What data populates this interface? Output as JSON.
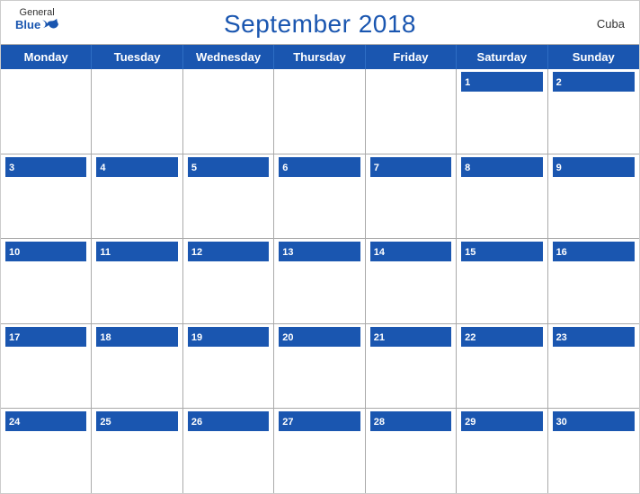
{
  "header": {
    "logo_general": "General",
    "logo_blue": "Blue",
    "title": "September 2018",
    "country": "Cuba"
  },
  "days_of_week": [
    "Monday",
    "Tuesday",
    "Wednesday",
    "Thursday",
    "Friday",
    "Saturday",
    "Sunday"
  ],
  "weeks": [
    [
      {
        "date": "",
        "empty": true
      },
      {
        "date": "",
        "empty": true
      },
      {
        "date": "",
        "empty": true
      },
      {
        "date": "",
        "empty": true
      },
      {
        "date": "",
        "empty": true
      },
      {
        "date": "1",
        "empty": false
      },
      {
        "date": "2",
        "empty": false
      }
    ],
    [
      {
        "date": "3",
        "empty": false
      },
      {
        "date": "4",
        "empty": false
      },
      {
        "date": "5",
        "empty": false
      },
      {
        "date": "6",
        "empty": false
      },
      {
        "date": "7",
        "empty": false
      },
      {
        "date": "8",
        "empty": false
      },
      {
        "date": "9",
        "empty": false
      }
    ],
    [
      {
        "date": "10",
        "empty": false
      },
      {
        "date": "11",
        "empty": false
      },
      {
        "date": "12",
        "empty": false
      },
      {
        "date": "13",
        "empty": false
      },
      {
        "date": "14",
        "empty": false
      },
      {
        "date": "15",
        "empty": false
      },
      {
        "date": "16",
        "empty": false
      }
    ],
    [
      {
        "date": "17",
        "empty": false
      },
      {
        "date": "18",
        "empty": false
      },
      {
        "date": "19",
        "empty": false
      },
      {
        "date": "20",
        "empty": false
      },
      {
        "date": "21",
        "empty": false
      },
      {
        "date": "22",
        "empty": false
      },
      {
        "date": "23",
        "empty": false
      }
    ],
    [
      {
        "date": "24",
        "empty": false
      },
      {
        "date": "25",
        "empty": false
      },
      {
        "date": "26",
        "empty": false
      },
      {
        "date": "27",
        "empty": false
      },
      {
        "date": "28",
        "empty": false
      },
      {
        "date": "29",
        "empty": false
      },
      {
        "date": "30",
        "empty": false
      }
    ]
  ],
  "colors": {
    "blue": "#1a56b0",
    "white": "#ffffff",
    "border": "#aaaaaa"
  }
}
